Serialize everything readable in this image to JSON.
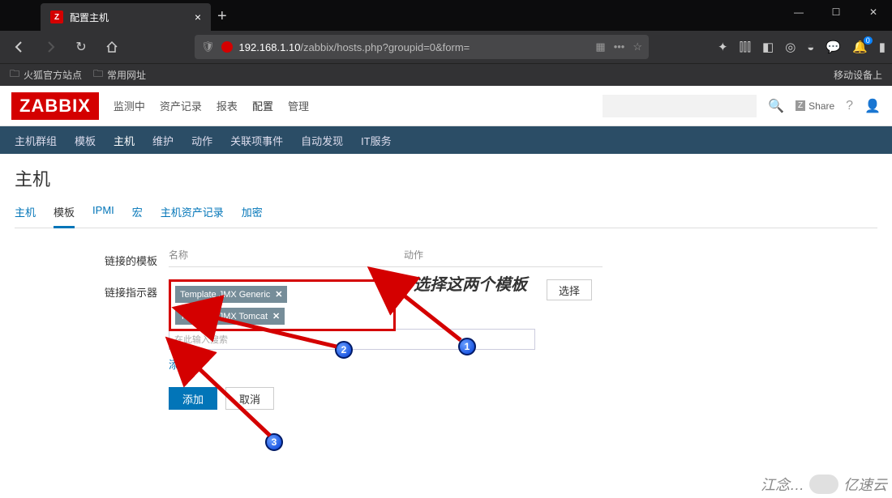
{
  "browser": {
    "tab_title": "配置主机",
    "url_prefix": "192.168.1.10",
    "url_path": "/zabbix/hosts.php?groupid=0&form=",
    "bookmarks": [
      "火狐官方站点",
      "常用网址"
    ],
    "mobile_hint": "移动设备上",
    "notif_count": "0"
  },
  "zabbix": {
    "logo": "ZABBIX",
    "topnav": [
      "监测中",
      "资产记录",
      "报表",
      "配置",
      "管理"
    ],
    "topnav_active": "配置",
    "share": "Share",
    "subnav": [
      "主机群组",
      "模板",
      "主机",
      "维护",
      "动作",
      "关联项事件",
      "自动发现",
      "IT服务"
    ],
    "subnav_active": "主机",
    "page_title": "主机",
    "tabs": [
      "主机",
      "模板",
      "IPMI",
      "宏",
      "主机资产记录",
      "加密"
    ],
    "tabs_active": "模板",
    "form": {
      "linked_label": "链接的模板",
      "col_name": "名称",
      "col_action": "动作",
      "indicator_label": "链接指示器",
      "tags": [
        "Template JMX Generic",
        "Template JMX Tomcat"
      ],
      "input_placeholder": "在此输入搜索",
      "select_btn": "选择",
      "add_link": "添加",
      "submit": "添加",
      "cancel": "取消"
    }
  },
  "annotations": {
    "hint": "选择这两个模板",
    "markers": [
      "1",
      "2",
      "3"
    ],
    "watermark_text": "江念…",
    "watermark_brand": "亿速云"
  }
}
